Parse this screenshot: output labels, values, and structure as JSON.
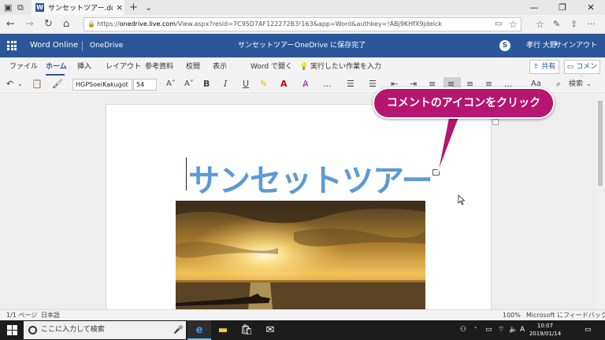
{
  "browser": {
    "tab_title": "サンセットツアー.docx - Mi",
    "tab_icon_letter": "W",
    "url_prefix": "https://",
    "url_host": "onedrive.live.com",
    "url_rest": "/View.aspx?resid=7C95D7AF122272B3!163&app=Word&authkey=!ABj9KHfX9jdelck"
  },
  "word_header": {
    "app_name": "Word Online",
    "location": "OneDrive",
    "doc_title": "サンセットツアー",
    "separator": "-",
    "save_status": "OneDrive に保存完了",
    "user_name": "孝行 大野",
    "sign_out": "サインアウト"
  },
  "ribbon_tabs": [
    {
      "label": "ファイル"
    },
    {
      "label": "ホーム"
    },
    {
      "label": "挿入"
    },
    {
      "label": "レイアウト"
    },
    {
      "label": "参考資料"
    },
    {
      "label": "校閲"
    },
    {
      "label": "表示"
    },
    {
      "label": "Word で開く"
    },
    {
      "label": "実行したい作業を入力"
    }
  ],
  "ribbon_buttons": {
    "share": "共有",
    "comment": "コメント"
  },
  "toolbar": {
    "font_name": "HGPSoeiKakugot",
    "font_size": "54",
    "bold": "B",
    "italic": "I",
    "underline": "U",
    "more": "...",
    "find": "検索"
  },
  "document": {
    "heading": "サンセットツアー"
  },
  "callout": {
    "text": "コメントのアイコンをクリック",
    "color": "#b5166f"
  },
  "status_bar": {
    "page": "1/1 ページ",
    "language": "日本語",
    "zoom": "100%",
    "feedback": "Microsoft にフィードバックを送信"
  },
  "taskbar": {
    "search_placeholder": "ここに入力して検索",
    "ime": "A",
    "time": "10:07",
    "date": "2019/01/14"
  },
  "colors": {
    "word_blue": "#2b579a",
    "heading_blue": "#5b9bd5"
  }
}
